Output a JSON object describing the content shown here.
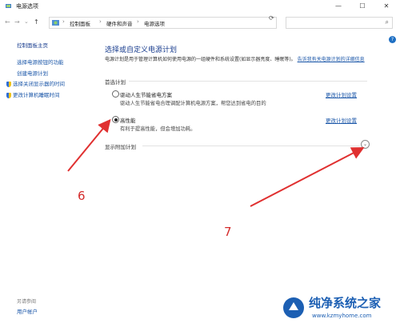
{
  "window": {
    "title": "电源选项",
    "controls": [
      "—",
      "☐",
      "✕"
    ]
  },
  "address": {
    "crumbs": [
      "控制面板",
      "硬件和声音",
      "电源选项"
    ],
    "nav": [
      "←",
      "→",
      "⌄",
      "↑"
    ],
    "refresh": "⟳",
    "search_placeholder": ""
  },
  "help": "?",
  "sidebar": {
    "home": "控制面板主页",
    "items": [
      "选择电源按钮的功能",
      "创建电源计划",
      "选择关闭显示器的时间",
      "更改计算机睡眠时间"
    ],
    "see_also": "另请参阅",
    "user_accounts": "用户帐户"
  },
  "main": {
    "title": "选择或自定义电源计划",
    "desc": "电源计划是用于管理计算机如何使用电源的一组硬件和系统设置(如显示器亮度、睡眠等)。",
    "desc_link": "告诉我有关电源计划的详细信息",
    "preferred": "首选计划",
    "plans": [
      {
        "name": "驱动人生节能省电方案",
        "desc": "驱动人生节能省电合理调配计算机电源方案，帮您达到省电的目的",
        "change": "更改计划设置",
        "selected": false
      },
      {
        "name": "高性能",
        "desc": "有利于提高性能，但会增加功耗。",
        "change": "更改计划设置",
        "selected": true
      }
    ],
    "show_more": "显示附加计划",
    "expand_icon": "chevron-down-icon"
  },
  "annotations": {
    "label6": "6",
    "label7": "7",
    "color": "#d42a2a"
  },
  "watermark": {
    "title": "纯净系统之家",
    "url": "www.kzmyhome.com"
  }
}
